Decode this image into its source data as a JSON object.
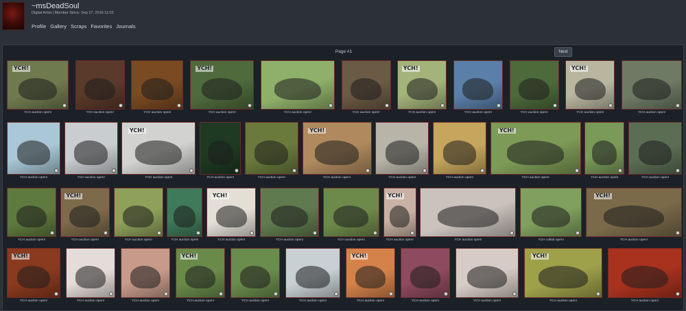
{
  "profile": {
    "username": "~msDeadSoul",
    "subtitle": "Digital Artist | Member Since: Sep 17, 2016 11:03",
    "nav": [
      "Profile",
      "Gallery",
      "Scraps",
      "Favorites",
      "Journals"
    ]
  },
  "gallery": {
    "page_label": "Page #1",
    "next_label": "Next",
    "rows": [
      [
        {
          "caption": "YCH auction open!",
          "bg": "#6f7a4f"
        },
        {
          "caption": "YCH auction open!",
          "bg": "#5a3a2a"
        },
        {
          "caption": "YCH auction open!",
          "bg": "#7a4a22"
        },
        {
          "caption": "YCH auction open!",
          "bg": "#4f6a3c"
        },
        {
          "caption": "YCH auction open!",
          "bg": "#8fb06a"
        },
        {
          "caption": "YCH auction open!",
          "bg": "#6b5a44"
        },
        {
          "caption": "YCH auction open!",
          "bg": "#a4b37a"
        },
        {
          "caption": "YCH auction open!",
          "bg": "#5a7fa8"
        },
        {
          "caption": "YCH auction open!",
          "bg": "#4c6a3a"
        },
        {
          "caption": "YCH auction open!",
          "bg": "#b9b6a0"
        },
        {
          "caption": "YCH auction open!",
          "bg": "#6e7a64"
        }
      ],
      [
        {
          "caption": "YCH auction open!",
          "bg": "#a9c7d6"
        },
        {
          "caption": "YCH auction open!",
          "bg": "#c9cdd0"
        },
        {
          "caption": "YCH auction open!",
          "bg": "#d2d3d0"
        },
        {
          "caption": "YCH auction open!",
          "bg": "#1e3a22"
        },
        {
          "caption": "YCH auction open!",
          "bg": "#6a7a3c"
        },
        {
          "caption": "YCH auction open!",
          "bg": "#b08a5e"
        },
        {
          "caption": "YCH auction open!",
          "bg": "#b8b4a8"
        },
        {
          "caption": "YCH auction open!",
          "bg": "#c6a65c"
        },
        {
          "caption": "YCH auction open!",
          "bg": "#7d9a56"
        },
        {
          "caption": "YCH auction open!",
          "bg": "#7a9a5a"
        },
        {
          "caption": "YCH auction open!",
          "bg": "#5b6e54"
        }
      ],
      [
        {
          "caption": "YCH auction open!",
          "bg": "#5f7a3e"
        },
        {
          "caption": "YCH auction open!",
          "bg": "#7c6a4a"
        },
        {
          "caption": "YCH auction open!",
          "bg": "#8ea05a"
        },
        {
          "caption": "YCH auction open!",
          "bg": "#3f7a5a"
        },
        {
          "caption": "YCH auction open!",
          "bg": "#e3dfd6"
        },
        {
          "caption": "YCH auction open!",
          "bg": "#5f7a4e"
        },
        {
          "caption": "YCH auction open!",
          "bg": "#6e8a4a"
        },
        {
          "caption": "YCH auction open!",
          "bg": "#c9b2a4"
        },
        {
          "caption": "YCH auction open!",
          "bg": "#c9c2bd"
        },
        {
          "caption": "YCH collab open!",
          "bg": "#7fa05e"
        },
        {
          "caption": "YCH auction open!",
          "bg": "#7a6a4a"
        }
      ],
      [
        {
          "caption": "YCH auction open!",
          "bg": "#8a3a1e"
        },
        {
          "caption": "YCH auction open!",
          "bg": "#e4dcd8"
        },
        {
          "caption": "YCH auction open!",
          "bg": "#c79a8a"
        },
        {
          "caption": "YCH auction open!",
          "bg": "#6a8a4a"
        },
        {
          "caption": "YCH auction open!",
          "bg": "#6a8c4c"
        },
        {
          "caption": "YCH auction open!",
          "bg": "#c8d0d4"
        },
        {
          "caption": "YCH auction open!",
          "bg": "#d4824a"
        },
        {
          "caption": "YCH auction open!",
          "bg": "#8e4a5e"
        },
        {
          "caption": "YCH auction open!",
          "bg": "#d7cbc6"
        },
        {
          "caption": "YCH auction open!",
          "bg": "#9ea04a"
        },
        {
          "caption": "YCH auction open!",
          "bg": "#a8321e"
        }
      ]
    ],
    "ych_text": "YCH!",
    "accent": "#6b2a2a"
  }
}
